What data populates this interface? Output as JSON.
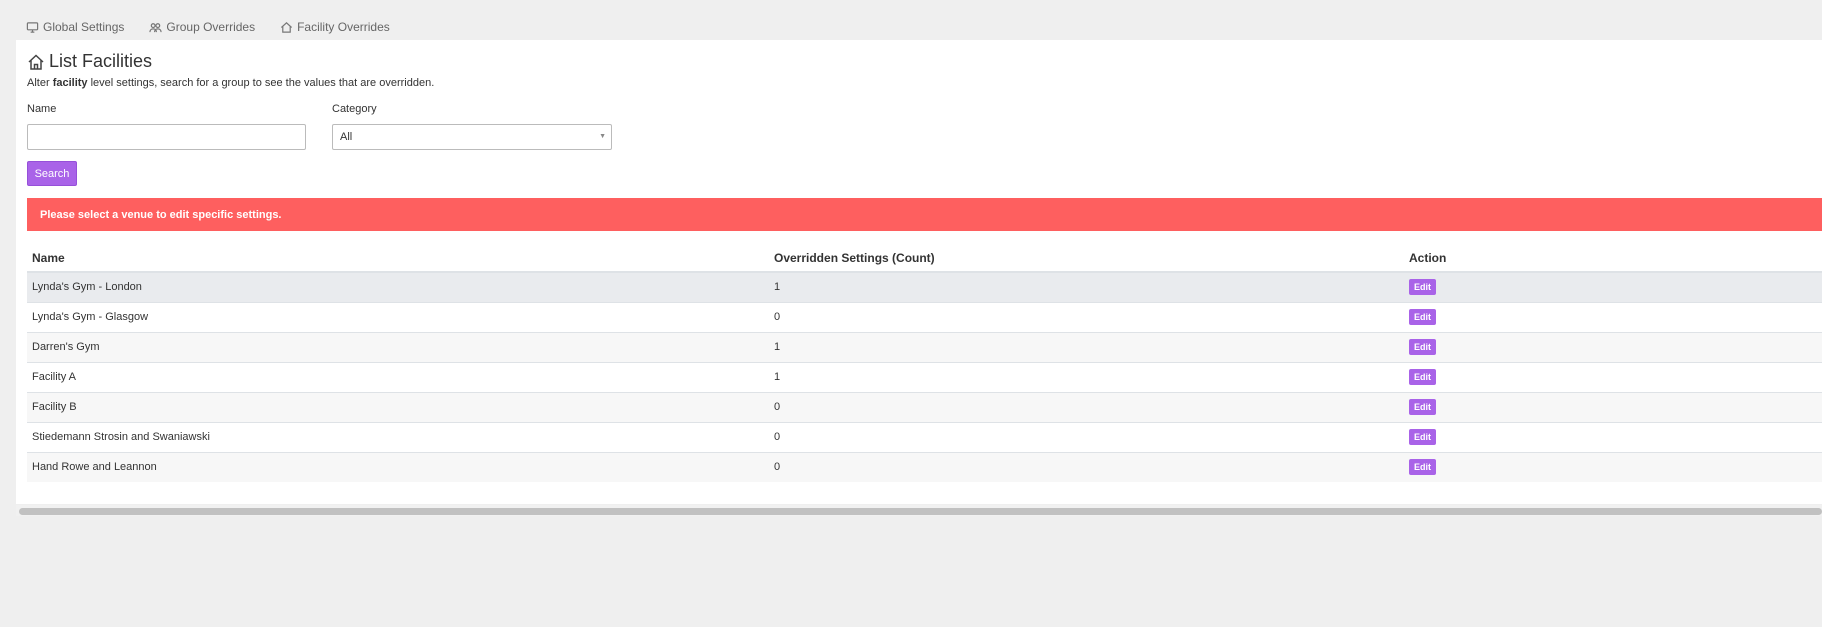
{
  "tabs": [
    {
      "label": "Global Settings",
      "icon": "monitor-icon"
    },
    {
      "label": "Group Overrides",
      "icon": "users-icon"
    },
    {
      "label": "Facility Overrides",
      "icon": "home-icon"
    }
  ],
  "header": {
    "title": "List Facilities",
    "subtitle_pre": "Alter ",
    "subtitle_bold": "facility",
    "subtitle_post": " level settings, search for a group to see the values that are overridden."
  },
  "filters": {
    "name_label": "Name",
    "name_value": "",
    "category_label": "Category",
    "category_value": "All",
    "search_label": "Search"
  },
  "alert": {
    "message": "Please select a venue to edit specific settings."
  },
  "table": {
    "headers": {
      "name": "Name",
      "count": "Overridden Settings (Count)",
      "action": "Action"
    },
    "edit_label": "Edit",
    "rows": [
      {
        "name": "Lynda's Gym - London",
        "count": "1"
      },
      {
        "name": "Lynda's Gym - Glasgow",
        "count": "0"
      },
      {
        "name": "Darren's Gym",
        "count": "1"
      },
      {
        "name": "Facility A",
        "count": "1"
      },
      {
        "name": "Facility B",
        "count": "0"
      },
      {
        "name": "Stiedemann Strosin and Swaniawski",
        "count": "0"
      },
      {
        "name": "Hand Rowe and Leannon",
        "count": "0"
      }
    ]
  },
  "colors": {
    "accent": "#a963e8",
    "alert": "#fe5f5f"
  }
}
